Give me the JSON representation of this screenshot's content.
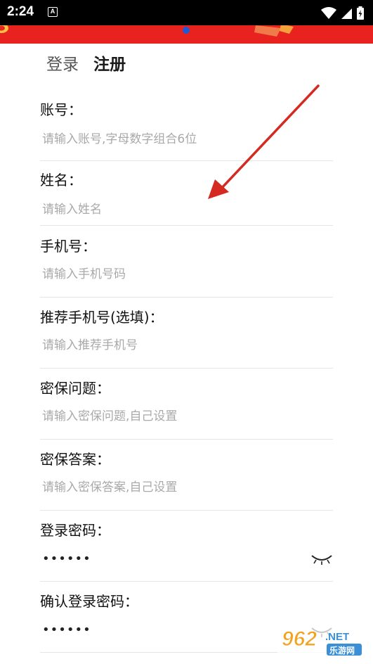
{
  "status_bar": {
    "time": "2:24",
    "app_icon_letter": "A"
  },
  "tabs": {
    "login": "登录",
    "register": "注册",
    "active": "register"
  },
  "fields": [
    {
      "label": "账号：",
      "placeholder": "请输入账号,字母数字组合6位",
      "value": ""
    },
    {
      "label": "姓名：",
      "placeholder": "请输入姓名",
      "value": ""
    },
    {
      "label": "手机号：",
      "placeholder": "请输入手机号码",
      "value": ""
    },
    {
      "label": "推荐手机号(选填)：",
      "placeholder": "请输入推荐手机号",
      "value": ""
    },
    {
      "label": "密保问题：",
      "placeholder": "请输入密保问题,自己设置",
      "value": ""
    },
    {
      "label": "密保答案：",
      "placeholder": "请输入密保答案,自己设置",
      "value": ""
    },
    {
      "label": "登录密码：",
      "value": "••••••"
    },
    {
      "label": "确认登录密码：",
      "value": "••••••"
    }
  ],
  "watermark": {
    "number": "962",
    "suffix": ".NET",
    "subtitle": "乐游网"
  },
  "colors": {
    "banner": "#e8231f",
    "arrow": "#d42a22",
    "divider": "#e5e5e5",
    "placeholder": "#a9a9a9"
  },
  "icons": {
    "password_toggle": "eye-closed-icon",
    "annotation": "arrow-icon"
  }
}
